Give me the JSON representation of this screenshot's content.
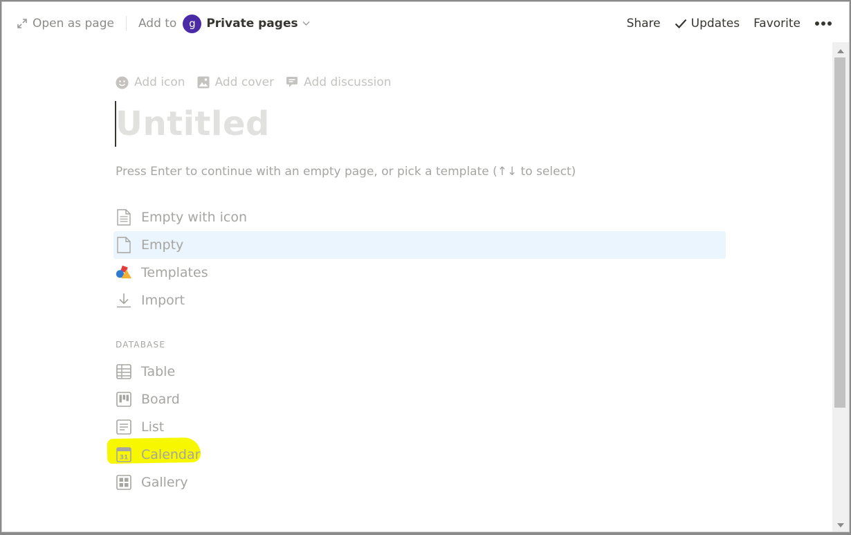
{
  "topbar": {
    "open_as_page": "Open as page",
    "add_to": "Add to",
    "workspace_initial": "g",
    "workspace_name": "Private pages",
    "share": "Share",
    "updates": "Updates",
    "favorite": "Favorite"
  },
  "page": {
    "actions": {
      "add_icon": "Add icon",
      "add_cover": "Add cover",
      "add_discussion": "Add discussion"
    },
    "title_placeholder": "Untitled",
    "hint": "Press Enter to continue with an empty page, or pick a template (↑↓ to select)"
  },
  "options": [
    {
      "label": "Empty with icon",
      "icon": "page-lines-icon"
    },
    {
      "label": "Empty",
      "icon": "page-icon"
    },
    {
      "label": "Templates",
      "icon": "shapes-icon"
    },
    {
      "label": "Import",
      "icon": "download-icon"
    }
  ],
  "database": {
    "heading": "DATABASE",
    "items": [
      {
        "label": "Table",
        "icon": "table-icon"
      },
      {
        "label": "Board",
        "icon": "board-icon"
      },
      {
        "label": "List",
        "icon": "list-icon"
      },
      {
        "label": "Calendar",
        "icon": "calendar-icon",
        "calendar_day": "31"
      },
      {
        "label": "Gallery",
        "icon": "gallery-icon"
      }
    ]
  },
  "colors": {
    "accent_avatar": "#4b2aa6",
    "selected_row": "#ebf5fd",
    "highlight": "#f7f700"
  }
}
